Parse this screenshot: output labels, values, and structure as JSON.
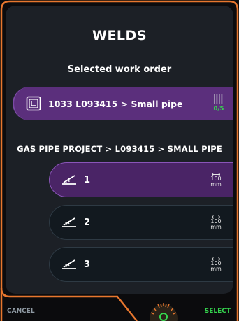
{
  "header": {
    "title": "WELDS",
    "subtitle": "Selected work order"
  },
  "work_order": {
    "label": "1033 L093415 > Small pipe",
    "progress_text": "0/5",
    "icon": "work-order-document-icon",
    "progress_icon": "progress-bars-icon"
  },
  "weld_list": {
    "heading": "GAS PIPE PROJECT > L093415 > SMALL PIPE",
    "items": [
      {
        "number": "1",
        "length_value": "100",
        "length_unit": "mm",
        "selected": true
      },
      {
        "number": "2",
        "length_value": "100",
        "length_unit": "mm",
        "selected": false
      },
      {
        "number": "3",
        "length_value": "100",
        "length_unit": "mm",
        "selected": false
      }
    ]
  },
  "footer": {
    "cancel_label": "CANCEL",
    "select_label": "SELECT",
    "knob_icon": "rotary-knob-icon"
  },
  "colors": {
    "accent_orange": "#e8772e",
    "selected_purple": "#5b2f7c",
    "status_green": "#35d64e",
    "panel_bg": "#1c2026"
  }
}
